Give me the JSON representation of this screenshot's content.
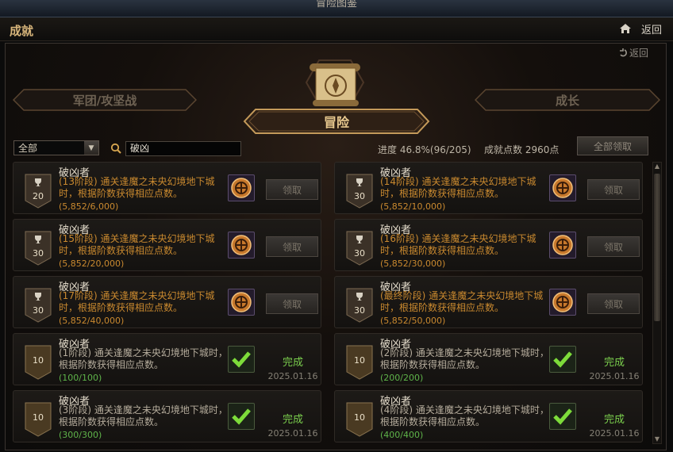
{
  "window": {
    "title": "冒险图鉴"
  },
  "header": {
    "title": "成就",
    "back_label": "返回"
  },
  "panel": {
    "back_label": "返回"
  },
  "tabs": {
    "left": "军团/攻坚战",
    "active": "冒险",
    "right": "成长"
  },
  "filter": {
    "value": "全部"
  },
  "search": {
    "value": "破凶"
  },
  "stats": {
    "progress": "进度 46.8%(96/205)",
    "points": "成就点数 2960点"
  },
  "claim_all_label": "全部领取",
  "cards": [
    {
      "title": "破凶者",
      "stage": "(13阶段)",
      "desc": "通关逢魔之未央幻境地下城时，根据阶数获得相应点数。",
      "progress": "(5,852/6,000)",
      "points": "20",
      "action": "领取"
    },
    {
      "title": "破凶者",
      "stage": "(14阶段)",
      "desc": "通关逢魔之未央幻境地下城时，根据阶数获得相应点数。",
      "progress": "(5,852/10,000)",
      "points": "30",
      "action": "领取"
    },
    {
      "title": "破凶者",
      "stage": "(15阶段)",
      "desc": "通关逢魔之未央幻境地下城时，根据阶数获得相应点数。",
      "progress": "(5,852/20,000)",
      "points": "30",
      "action": "领取"
    },
    {
      "title": "破凶者",
      "stage": "(16阶段)",
      "desc": "通关逢魔之未央幻境地下城时，根据阶数获得相应点数。",
      "progress": "(5,852/30,000)",
      "points": "30",
      "action": "领取"
    },
    {
      "title": "破凶者",
      "stage": "(17阶段)",
      "desc": "通关逢魔之未央幻境地下城时，根据阶数获得相应点数。",
      "progress": "(5,852/40,000)",
      "points": "30",
      "action": "领取"
    },
    {
      "title": "破凶者",
      "stage": "(最终阶段)",
      "desc": "通关逢魔之未央幻境地下城时，根据阶数获得相应点数。",
      "progress": "(5,852/50,000)",
      "points": "30",
      "action": "领取"
    },
    {
      "title": "破凶者",
      "stage": "(1阶段)",
      "desc": "通关逢魔之未央幻境地下城时，根据阶数获得相应点数。",
      "progress": "(100/100)",
      "points": "10",
      "status": "完成",
      "date": "2025.01.16"
    },
    {
      "title": "破凶者",
      "stage": "(2阶段)",
      "desc": "通关逢魔之未央幻境地下城时，根据阶数获得相应点数。",
      "progress": "(200/200)",
      "points": "10",
      "status": "完成",
      "date": "2025.01.16"
    },
    {
      "title": "破凶者",
      "stage": "(3阶段)",
      "desc": "通关逢魔之未央幻境地下城时，根据阶数获得相应点数。",
      "progress": "(300/300)",
      "points": "10",
      "status": "完成",
      "date": "2025.01.16"
    },
    {
      "title": "破凶者",
      "stage": "(4阶段)",
      "desc": "通关逢魔之未央幻境地下城时，根据阶数获得相应点数。",
      "progress": "(400/400)",
      "points": "10",
      "status": "完成",
      "date": "2025.01.16"
    }
  ]
}
